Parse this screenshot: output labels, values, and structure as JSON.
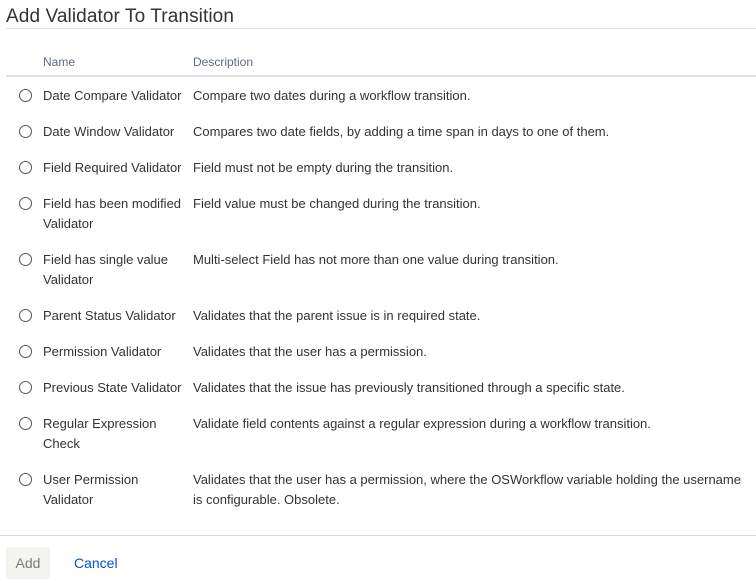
{
  "dialog": {
    "title": "Add Validator To Transition"
  },
  "table": {
    "columns": {
      "name": "Name",
      "description": "Description"
    },
    "rows": [
      {
        "name": "Date Compare Validator",
        "description": "Compare two dates during a workflow transition."
      },
      {
        "name": "Date Window Validator",
        "description": "Compares two date fields, by adding a time span in days to one of them."
      },
      {
        "name": "Field Required Validator",
        "description": "Field must not be empty during the transition."
      },
      {
        "name": "Field has been modified Validator",
        "description": "Field value must be changed during the transition."
      },
      {
        "name": "Field has single value Validator",
        "description": "Multi-select Field has not more than one value during transition."
      },
      {
        "name": "Parent Status Validator",
        "description": "Validates that the parent issue is in required state."
      },
      {
        "name": "Permission Validator",
        "description": "Validates that the user has a permission."
      },
      {
        "name": "Previous State Validator",
        "description": "Validates that the issue has previously transitioned through a specific state."
      },
      {
        "name": "Regular Expression Check",
        "description": "Validate field contents against a regular expression during a workflow transition."
      },
      {
        "name": "User Permission Validator",
        "description": "Validates that the user has a permission, where the OSWorkflow variable holding the username is configurable. Obsolete."
      }
    ],
    "selected_index": null
  },
  "footer": {
    "add_label": "Add",
    "cancel_label": "Cancel"
  },
  "colors": {
    "link": "#0052cc",
    "add_button_bg": "#f4f5f0"
  }
}
